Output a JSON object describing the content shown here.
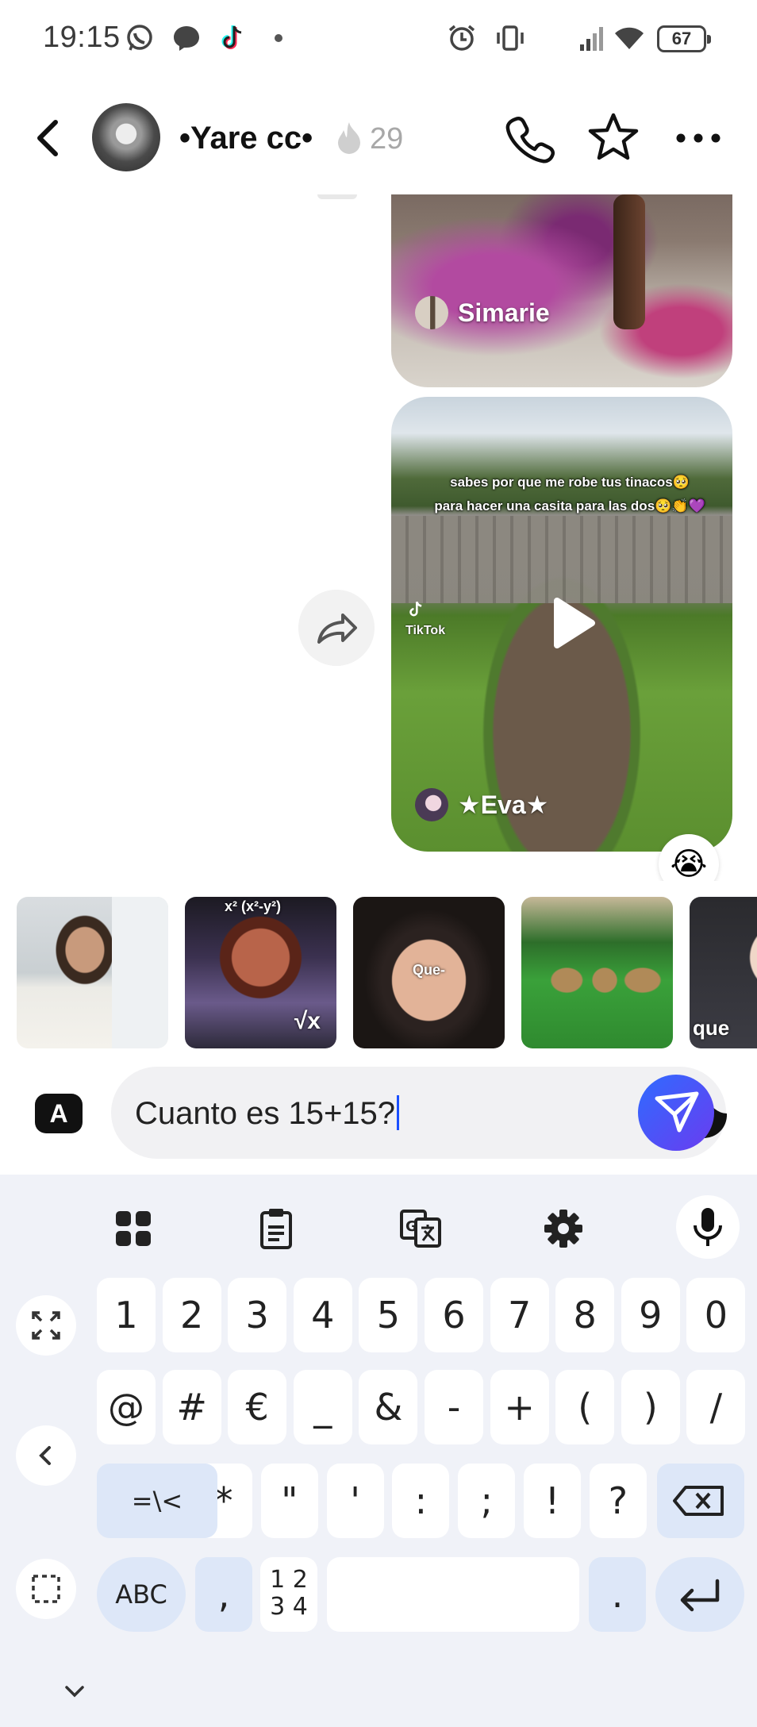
{
  "status_bar": {
    "time": "19:15",
    "battery": "67",
    "icons": [
      "whatsapp-icon",
      "messenger-icon",
      "tiktok-icon",
      "dot-icon",
      "alarm-icon",
      "vibrate-icon",
      "signal-icon",
      "wifi-icon",
      "battery-icon"
    ]
  },
  "header": {
    "contact_name": "•Yare cc•",
    "streak_count": "29",
    "icons": [
      "back-icon",
      "phone-icon",
      "star-icon",
      "more-icon"
    ]
  },
  "messages": [
    {
      "type": "video",
      "author": "Simarie"
    },
    {
      "type": "video",
      "author": "★Eva★",
      "overlay_line_1": "sabes por que me robe tus tinacos🥺",
      "overlay_line_2": "para hacer una casita para las dos🥺👏💜",
      "watermark": "TikTok",
      "reaction": "😭"
    }
  ],
  "gif_strip": [
    {
      "caption": ""
    },
    {
      "caption": ""
    },
    {
      "caption": "Que-"
    },
    {
      "caption": ""
    },
    {
      "caption": "que"
    }
  ],
  "composer": {
    "mode_key": "A",
    "text": "Cuanto es 15+15?"
  },
  "keyboard": {
    "row1": [
      "1",
      "2",
      "3",
      "4",
      "5",
      "6",
      "7",
      "8",
      "9",
      "0"
    ],
    "row2": [
      "@",
      "#",
      "€",
      "_",
      "&",
      "-",
      "+",
      "(",
      ")",
      "/"
    ],
    "row3": [
      "=\\<",
      "*",
      "\"",
      "'",
      ":",
      ";",
      "!",
      "?"
    ],
    "row4": {
      "abc": "ABC",
      "comma": ",",
      "numpad_top": "1 2",
      "numpad_bottom": "3 4",
      "period": "."
    },
    "colors": {
      "background": "#f0f2f8",
      "fn_key": "#dde7f8",
      "key": "#ffffff"
    }
  },
  "colors": {
    "send_start": "#2f6bff",
    "send_end": "#6a3cf0",
    "caret": "#1a4fff"
  }
}
